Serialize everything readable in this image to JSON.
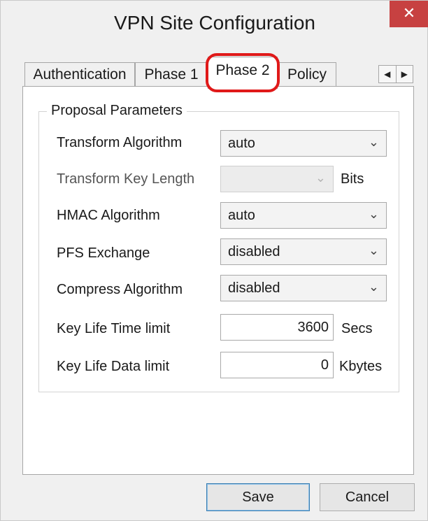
{
  "window": {
    "title": "VPN Site Configuration",
    "close_glyph": "✕"
  },
  "tabs": [
    {
      "label": "Authentication",
      "active": false
    },
    {
      "label": "Phase 1",
      "active": false
    },
    {
      "label": "Phase 2",
      "active": true
    },
    {
      "label": "Policy",
      "active": false
    }
  ],
  "tab_scroll": {
    "left": "◀",
    "right": "▶"
  },
  "highlight_color": "#e01919",
  "group": {
    "title": "Proposal Parameters"
  },
  "fields": {
    "transform_algorithm": {
      "label": "Transform Algorithm",
      "value": "auto",
      "icon": "chevron-down-icon"
    },
    "transform_key_length": {
      "label": "Transform Key Length",
      "value": "",
      "unit": "Bits",
      "disabled": true
    },
    "hmac_algorithm": {
      "label": "HMAC Algorithm",
      "value": "auto"
    },
    "pfs_exchange": {
      "label": "PFS Exchange",
      "value": "disabled"
    },
    "compress_algorithm": {
      "label": "Compress Algorithm",
      "value": "disabled"
    },
    "key_life_time": {
      "label": "Key Life Time limit",
      "value": "3600",
      "unit": "Secs"
    },
    "key_life_data": {
      "label": "Key Life Data limit",
      "value": "0",
      "unit": "Kbytes"
    }
  },
  "chevron": "⌄",
  "buttons": {
    "save": "Save",
    "cancel": "Cancel"
  }
}
